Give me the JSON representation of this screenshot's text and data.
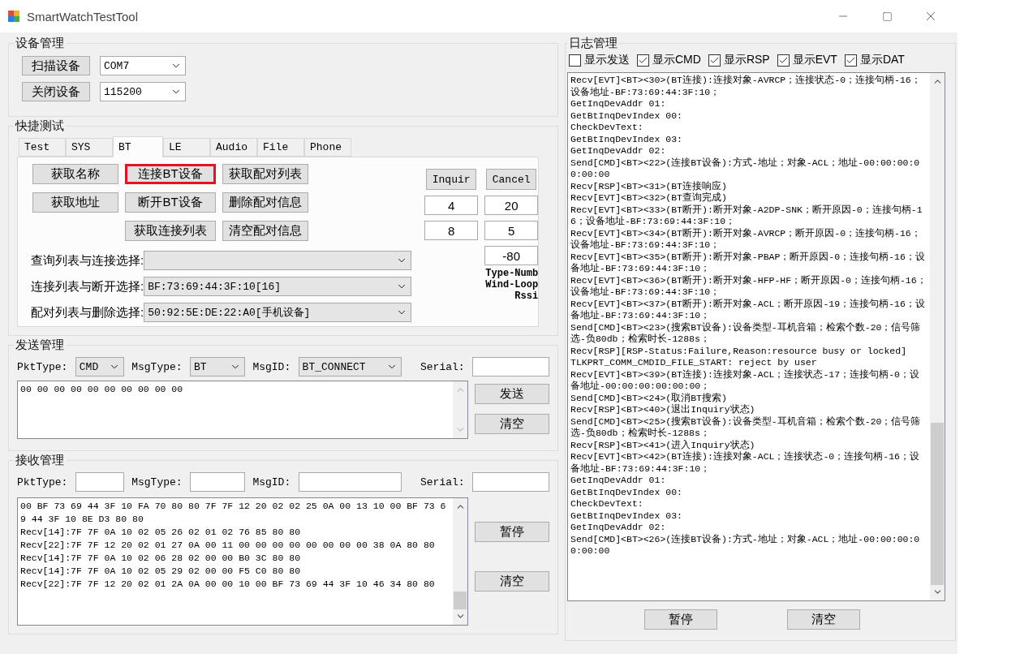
{
  "window": {
    "title": "SmartWatchTestTool"
  },
  "device_management": {
    "title": "设备管理",
    "rows": [
      {
        "button": "扫描设备",
        "value": "COM7"
      },
      {
        "button": "关闭设备",
        "value": "115200"
      }
    ]
  },
  "quick_test": {
    "title": "快捷测试",
    "tabs": [
      {
        "label": "Test",
        "selected": false
      },
      {
        "label": "SYS",
        "selected": false
      },
      {
        "label": "BT",
        "selected": true
      },
      {
        "label": "LE",
        "selected": false
      },
      {
        "label": "Audio",
        "selected": false
      },
      {
        "label": "File",
        "selected": false
      },
      {
        "label": "Phone",
        "selected": false
      }
    ],
    "button_rows": [
      {
        "indented": false,
        "buttons": [
          {
            "label": "获取名称",
            "highlighted": false
          },
          {
            "label": "连接BT设备",
            "highlighted": true
          },
          {
            "label": "获取配对列表",
            "highlighted": false
          }
        ]
      },
      {
        "indented": false,
        "buttons": [
          {
            "label": "获取地址",
            "highlighted": false
          },
          {
            "label": "断开BT设备",
            "highlighted": false
          },
          {
            "label": "删除配对信息",
            "highlighted": false
          }
        ]
      },
      {
        "indented": true,
        "buttons": [
          {
            "label": "获取连接列表",
            "highlighted": false
          },
          {
            "label": "清空配对信息",
            "highlighted": false
          }
        ]
      }
    ],
    "selectors": [
      {
        "label": "查询列表与连接选择:"
      },
      {
        "label": "连接列表与断开选择:",
        "value": "BF:73:69:44:3F:10[16]"
      },
      {
        "label": "配对列表与删除选择:",
        "value": "50:92:5E:DE:22:A0[手机设备]"
      }
    ],
    "inquiry": {
      "buttons": [
        "Inquir",
        "Cancel"
      ],
      "fields": [
        "4",
        "20",
        "8",
        "5",
        "-80"
      ],
      "labels": [
        "Type-Numb",
        "Wind-Loop",
        "Rssi"
      ]
    }
  },
  "send": {
    "title": "发送管理",
    "pkt_type": {
      "label": "PktType:",
      "value": "CMD"
    },
    "msg_type": {
      "label": "MsgType:",
      "value": "BT"
    },
    "msg_id": {
      "label": "MsgID:",
      "value": "BT_CONNECT"
    },
    "serial": {
      "label": "Serial:"
    },
    "data": "00 00 00 00 00 00 00 00 00 00",
    "buttons": [
      "发送",
      "清空"
    ]
  },
  "receive": {
    "title": "接收管理",
    "pkt_type": {
      "label": "PktType:"
    },
    "msg_type": {
      "label": "MsgType:"
    },
    "msg_id": {
      "label": "MsgID:"
    },
    "serial": {
      "label": "Serial:"
    },
    "lines": [
      "00 BF 73 69 44 3F 10 FA 70 80 80 7F 7F 12 20 02 02 25 0A 00 13 10 00 BF 73 69 44 3F 10 8E D3 80 80",
      "Recv[14]:7F 7F 0A 10 02 05 26 02 01 02 76 85 80 80",
      "Recv[22]:7F 7F 12 20 02 01 27 0A 00 11 00 00 00 00 00 00 00 00 38 0A 80 80",
      "Recv[14]:7F 7F 0A 10 02 06 28 02 00 00 B0 3C 80 80",
      "Recv[14]:7F 7F 0A 10 02 05 29 02 00 00 F5 C0 80 80",
      "Recv[22]:7F 7F 12 20 02 01 2A 0A 00 00 10 00 BF 73 69 44 3F 10 46 34 80 80"
    ],
    "buttons": [
      "暂停",
      "清空"
    ]
  },
  "log": {
    "title": "日志管理",
    "filters": [
      {
        "label": "显示发送",
        "checked": false
      },
      {
        "label": "显示CMD",
        "checked": true
      },
      {
        "label": "显示RSP",
        "checked": true
      },
      {
        "label": "显示EVT",
        "checked": true
      },
      {
        "label": "显示DAT",
        "checked": true
      }
    ],
    "entries": [
      "Recv[EVT]<BT><30>(BT连接):连接对象-AVRCP；连接状态-0；连接句柄-16；设备地址-BF:73:69:44:3F:10；",
      "GetInqDevAddr 01:",
      "GetBtInqDevIndex 00:",
      "CheckDevText:",
      "GetBtInqDevIndex 03:",
      "GetInqDevAddr 02:",
      "Send[CMD]<BT><22>(连接BT设备):方式-地址；对象-ACL；地址-00:00:00:00:00:00",
      "Recv[RSP]<BT><31>(BT连接响应)",
      "Recv[EVT]<BT><32>(BT查询完成)",
      "Recv[EVT]<BT><33>(BT断开):断开对象-A2DP-SNK；断开原因-0；连接句柄-16；设备地址-BF:73:69:44:3F:10；",
      "Recv[EVT]<BT><34>(BT断开):断开对象-AVRCP；断开原因-0；连接句柄-16；设备地址-BF:73:69:44:3F:10；",
      "Recv[EVT]<BT><35>(BT断开):断开对象-PBAP；断开原因-0；连接句柄-16；设备地址-BF:73:69:44:3F:10；",
      "Recv[EVT]<BT><36>(BT断开):断开对象-HFP-HF；断开原因-0；连接句柄-16；设备地址-BF:73:69:44:3F:10；",
      "Recv[EVT]<BT><37>(BT断开):断开对象-ACL；断开原因-19；连接句柄-16；设备地址-BF:73:69:44:3F:10；",
      "Send[CMD]<BT><23>(搜索BT设备):设备类型-耳机音箱；检索个数-20；信号筛选-负80db；检索时长-1288s；",
      "Recv[RSP][RSP-Status:Failure,Reason:resource busy or locked]",
      "TLKPRT_COMM_CMDID_FILE_START: reject by user",
      "Recv[EVT]<BT><39>(BT连接):连接对象-ACL；连接状态-17；连接句柄-0；设备地址-00:00:00:00:00:00；",
      "Send[CMD]<BT><24>(取消BT搜索)",
      "Recv[RSP]<BT><40>(退出Inquiry状态)",
      "Send[CMD]<BT><25>(搜索BT设备):设备类型-耳机音箱；检索个数-20；信号筛选-负80db；检索时长-1288s；",
      "Recv[RSP]<BT><41>(进入Inquiry状态)",
      "Recv[EVT]<BT><42>(BT连接):连接对象-ACL；连接状态-0；连接句柄-16；设备地址-BF:73:69:44:3F:10；",
      "GetInqDevAddr 01:",
      "GetBtInqDevIndex 00:",
      "CheckDevText:",
      "GetBtInqDevIndex 03:",
      "GetInqDevAddr 02:",
      "Send[CMD]<BT><26>(连接BT设备):方式-地址；对象-ACL；地址-00:00:00:00:00:00"
    ],
    "buttons": [
      "暂停",
      "清空"
    ]
  }
}
